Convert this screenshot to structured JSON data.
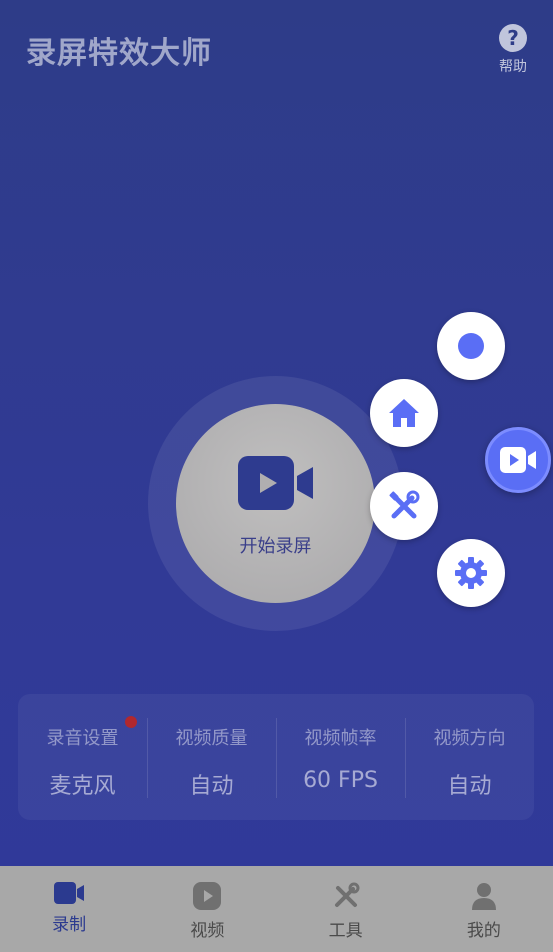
{
  "header": {
    "title": "录屏特效大师",
    "help_label": "帮助",
    "help_glyph": "?"
  },
  "record": {
    "label": "开始录屏",
    "icon": "video-camera-icon"
  },
  "float_menu": {
    "items": [
      "record-dot-icon",
      "home-icon",
      "tools-icon",
      "settings-icon"
    ],
    "main_icon": "video-camera-icon",
    "accent": "#5a6ef5"
  },
  "settings": [
    {
      "label": "录音设置",
      "value": "麦克风",
      "badge": true
    },
    {
      "label": "视频质量",
      "value": "自动"
    },
    {
      "label": "视频帧率",
      "value": "60 FPS"
    },
    {
      "label": "视频方向",
      "value": "自动"
    }
  ],
  "nav": [
    {
      "label": "录制",
      "icon": "video-camera-icon",
      "active": true
    },
    {
      "label": "视频",
      "icon": "play-icon"
    },
    {
      "label": "工具",
      "icon": "tools-icon"
    },
    {
      "label": "我的",
      "icon": "user-icon"
    }
  ],
  "colors": {
    "background": "#2e3c88",
    "active_nav": "#2b3a8f",
    "badge": "#b0282e"
  }
}
